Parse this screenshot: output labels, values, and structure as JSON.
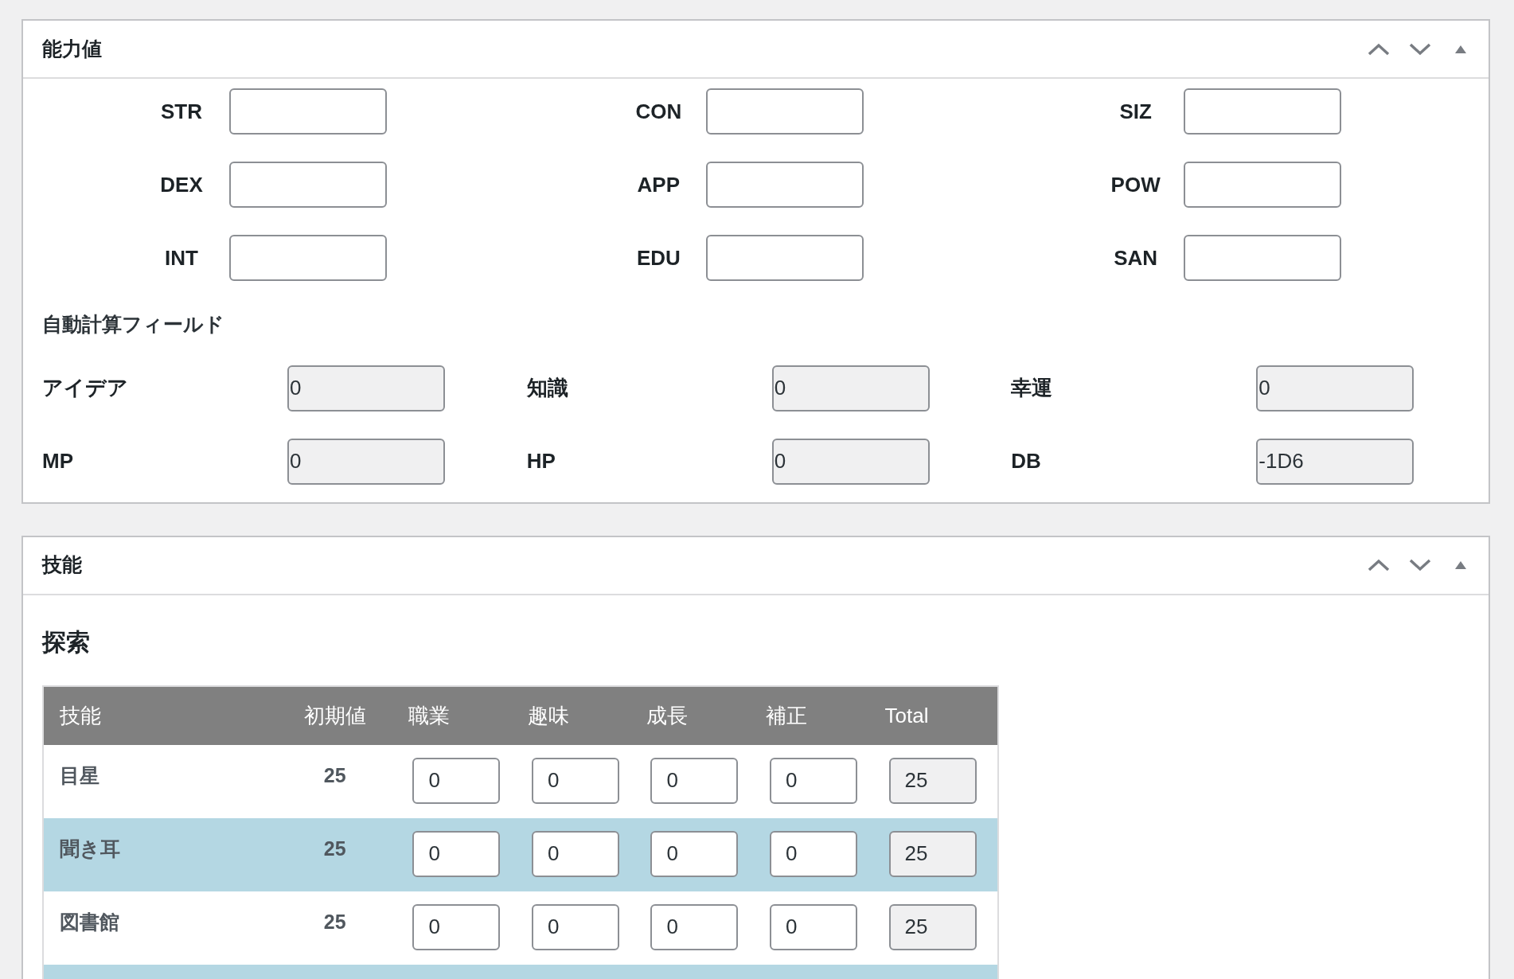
{
  "abilities_panel": {
    "title": "能力値",
    "stats": [
      {
        "label": "STR"
      },
      {
        "label": "CON"
      },
      {
        "label": "SIZ"
      },
      {
        "label": "DEX"
      },
      {
        "label": "APP"
      },
      {
        "label": "POW"
      },
      {
        "label": "INT"
      },
      {
        "label": "EDU"
      },
      {
        "label": "SAN"
      }
    ],
    "auto_section_title": "自動計算フィールド",
    "auto_fields": [
      {
        "label": "アイデア",
        "value": "0"
      },
      {
        "label": "知識",
        "value": "0"
      },
      {
        "label": "幸運",
        "value": "0"
      },
      {
        "label": "MP",
        "value": "0"
      },
      {
        "label": "HP",
        "value": "0"
      },
      {
        "label": "DB",
        "value": "-1D6"
      }
    ]
  },
  "skills_panel": {
    "title": "技能",
    "section_title": "探索",
    "table": {
      "columns": [
        "技能",
        "初期値",
        "職業",
        "趣味",
        "成長",
        "補正",
        "Total"
      ],
      "rows": [
        {
          "skill": "目星",
          "base": "25",
          "occupation": "0",
          "hobby": "0",
          "growth": "0",
          "bonus": "0",
          "total": "25"
        },
        {
          "skill": "聞き耳",
          "base": "25",
          "occupation": "0",
          "hobby": "0",
          "growth": "0",
          "bonus": "0",
          "total": "25"
        },
        {
          "skill": "図書館",
          "base": "25",
          "occupation": "0",
          "hobby": "0",
          "growth": "0",
          "bonus": "0",
          "total": "25"
        }
      ]
    }
  }
}
